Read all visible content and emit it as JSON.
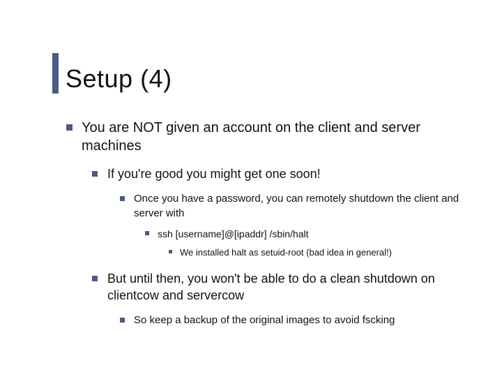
{
  "title": "Setup (4)",
  "b1": "You are NOT given an account on the client and server machines",
  "b1_1": "If you're good you might get one soon!",
  "b1_1_1": "Once you have a password, you can remotely shutdown the client and server with",
  "b1_1_1_1": "ssh [username]@[ipaddr] /sbin/halt",
  "b1_1_1_1_1": "We installed halt as setuid-root (bad idea in general!)",
  "b1_2": "But until then, you won't be able to do a clean shutdown on clientcow and servercow",
  "b1_2_1": "So keep a backup of the original images to avoid fscking"
}
